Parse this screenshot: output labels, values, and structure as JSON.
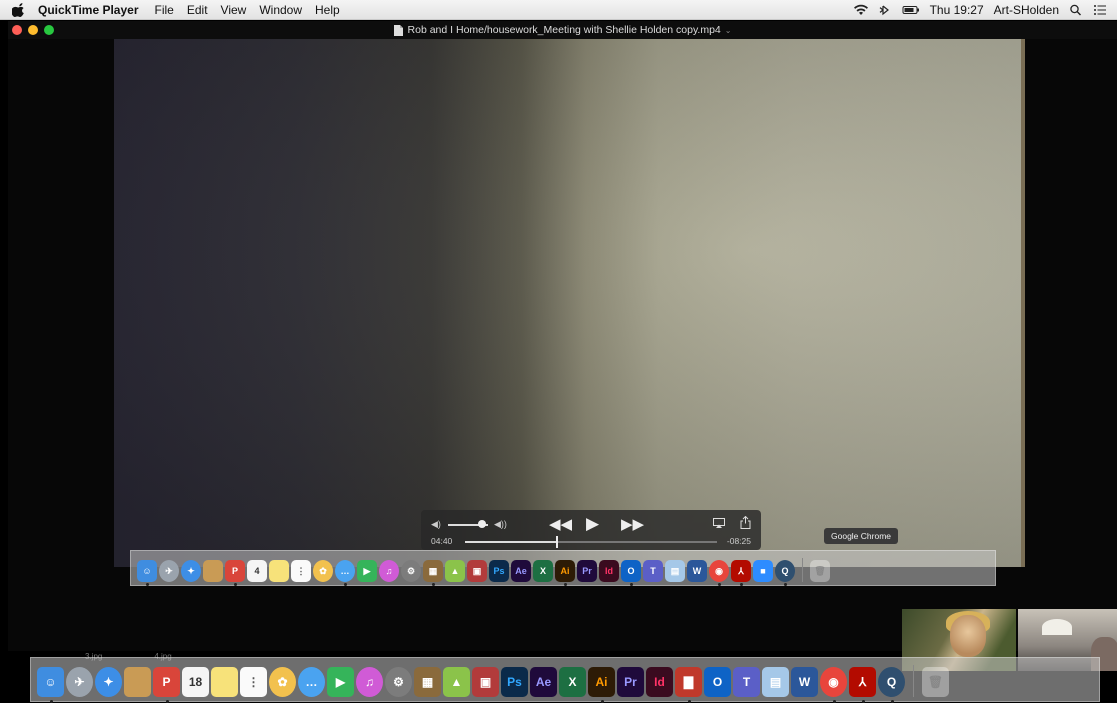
{
  "menubar": {
    "app_name": "QuickTime Player",
    "items": [
      "File",
      "Edit",
      "View",
      "Window",
      "Help"
    ],
    "clock": "Thu 19:27",
    "user": "Art-SHolden"
  },
  "window": {
    "title": "Rob and I Home/housework_Meeting with Shellie Holden copy.mp4"
  },
  "player": {
    "elapsed": "04:40",
    "remaining": "-08:25",
    "progress_fraction": 0.36,
    "volume_fraction": 0.85
  },
  "dock_tooltip": "Google Chrome",
  "background_labels": [
    "3.jpg",
    "4.jpg"
  ],
  "inner_dock": [
    {
      "name": "finder",
      "color": "#3f8de0",
      "glyph": "☺"
    },
    {
      "name": "launchpad",
      "color": "#9aa3ad",
      "glyph": "✈",
      "round": true
    },
    {
      "name": "safari",
      "color": "#3d8ee6",
      "glyph": "✦",
      "round": true
    },
    {
      "name": "folder",
      "color": "#c99b55",
      "glyph": ""
    },
    {
      "name": "photo-booth",
      "color": "#d9453a",
      "glyph": "P"
    },
    {
      "name": "calendar",
      "color": "#f5f5f5",
      "glyph": "4",
      "text": "#333"
    },
    {
      "name": "notes",
      "color": "#f7e27a",
      "glyph": ""
    },
    {
      "name": "reminders",
      "color": "#fafafa",
      "glyph": "⋮",
      "text": "#555"
    },
    {
      "name": "photos",
      "color": "#f2c14e",
      "glyph": "✿",
      "round": true
    },
    {
      "name": "messages",
      "color": "#4aa3f0",
      "glyph": "…",
      "round": true
    },
    {
      "name": "facetime",
      "color": "#35b45a",
      "glyph": "▶"
    },
    {
      "name": "itunes",
      "color": "#d05bd6",
      "glyph": "♫",
      "round": true
    },
    {
      "name": "system-preferences",
      "color": "#7c7c7c",
      "glyph": "⚙",
      "round": true
    },
    {
      "name": "minecraft",
      "color": "#8a6a3c",
      "glyph": "▦"
    },
    {
      "name": "android",
      "color": "#8bc34a",
      "glyph": "▲"
    },
    {
      "name": "games",
      "color": "#b23b3b",
      "glyph": "▣"
    },
    {
      "name": "photoshop",
      "color": "#0b2a4a",
      "glyph": "Ps",
      "text": "#31a8ff"
    },
    {
      "name": "after-effects",
      "color": "#1f0a3b",
      "glyph": "Ae",
      "text": "#9999ff"
    },
    {
      "name": "excel",
      "color": "#1d6f42",
      "glyph": "X"
    },
    {
      "name": "illustrator",
      "color": "#2d1b06",
      "glyph": "Ai",
      "text": "#ff9a00"
    },
    {
      "name": "premiere",
      "color": "#1f0a3b",
      "glyph": "Pr",
      "text": "#9999ff"
    },
    {
      "name": "indesign",
      "color": "#3a0b1f",
      "glyph": "Id",
      "text": "#ff3366"
    },
    {
      "name": "outlook",
      "color": "#0e63c6",
      "glyph": "O"
    },
    {
      "name": "teams",
      "color": "#5b5fc7",
      "glyph": "T"
    },
    {
      "name": "preview",
      "color": "#a5c8e8",
      "glyph": "▤"
    },
    {
      "name": "word",
      "color": "#2b579a",
      "glyph": "W"
    },
    {
      "name": "chrome",
      "color": "#e8453c",
      "glyph": "◉",
      "round": true
    },
    {
      "name": "acrobat",
      "color": "#b30b00",
      "glyph": "⅄"
    },
    {
      "name": "zoom",
      "color": "#2d8cff",
      "glyph": "■"
    },
    {
      "name": "quicktime",
      "color": "#2f4f6f",
      "glyph": "Q",
      "round": true
    }
  ],
  "main_dock": [
    {
      "name": "finder",
      "color": "#3f8de0",
      "glyph": "☺"
    },
    {
      "name": "launchpad",
      "color": "#9aa3ad",
      "glyph": "✈",
      "round": true
    },
    {
      "name": "safari",
      "color": "#3d8ee6",
      "glyph": "✦",
      "round": true
    },
    {
      "name": "folder",
      "color": "#c99b55",
      "glyph": ""
    },
    {
      "name": "photo-booth",
      "color": "#d9453a",
      "glyph": "P"
    },
    {
      "name": "calendar",
      "color": "#f5f5f5",
      "glyph": "18",
      "text": "#333"
    },
    {
      "name": "notes",
      "color": "#f7e27a",
      "glyph": ""
    },
    {
      "name": "reminders",
      "color": "#fafafa",
      "glyph": "⋮",
      "text": "#555"
    },
    {
      "name": "photos",
      "color": "#f2c14e",
      "glyph": "✿",
      "round": true
    },
    {
      "name": "messages",
      "color": "#4aa3f0",
      "glyph": "…",
      "round": true
    },
    {
      "name": "facetime",
      "color": "#35b45a",
      "glyph": "▶"
    },
    {
      "name": "itunes",
      "color": "#d05bd6",
      "glyph": "♫",
      "round": true
    },
    {
      "name": "system-preferences",
      "color": "#7c7c7c",
      "glyph": "⚙",
      "round": true
    },
    {
      "name": "minecraft",
      "color": "#8a6a3c",
      "glyph": "▦"
    },
    {
      "name": "android",
      "color": "#8bc34a",
      "glyph": "▲"
    },
    {
      "name": "games",
      "color": "#b23b3b",
      "glyph": "▣"
    },
    {
      "name": "photoshop",
      "color": "#0b2a4a",
      "glyph": "Ps",
      "text": "#31a8ff"
    },
    {
      "name": "after-effects",
      "color": "#1f0a3b",
      "glyph": "Ae",
      "text": "#9999ff"
    },
    {
      "name": "excel",
      "color": "#1d6f42",
      "glyph": "X"
    },
    {
      "name": "illustrator",
      "color": "#2d1b06",
      "glyph": "Ai",
      "text": "#ff9a00"
    },
    {
      "name": "premiere",
      "color": "#1f0a3b",
      "glyph": "Pr",
      "text": "#9999ff"
    },
    {
      "name": "indesign",
      "color": "#3a0b1f",
      "glyph": "Id",
      "text": "#ff3366"
    },
    {
      "name": "video-app",
      "color": "#c0392b",
      "glyph": "▇"
    },
    {
      "name": "outlook",
      "color": "#0e63c6",
      "glyph": "O"
    },
    {
      "name": "teams",
      "color": "#5b5fc7",
      "glyph": "T"
    },
    {
      "name": "preview",
      "color": "#a5c8e8",
      "glyph": "▤"
    },
    {
      "name": "word",
      "color": "#2b579a",
      "glyph": "W"
    },
    {
      "name": "chrome",
      "color": "#e8453c",
      "glyph": "◉",
      "round": true
    },
    {
      "name": "acrobat",
      "color": "#b30b00",
      "glyph": "⅄"
    },
    {
      "name": "quicktime",
      "color": "#2f4f6f",
      "glyph": "Q",
      "round": true
    }
  ]
}
